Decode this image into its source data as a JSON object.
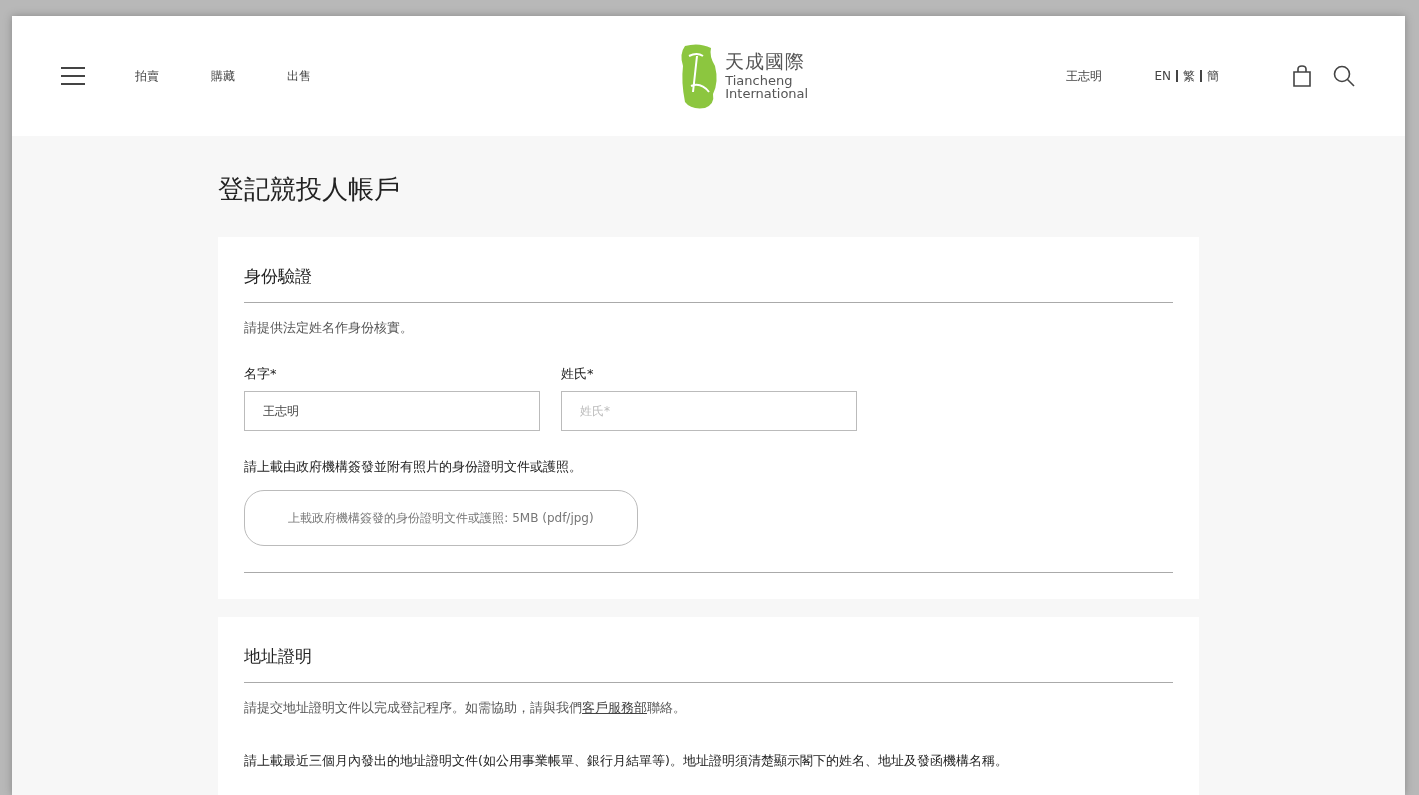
{
  "header": {
    "nav": [
      "拍賣",
      "購藏",
      "出售"
    ],
    "logo": {
      "chinese": "天成國際",
      "line1": "Tiancheng",
      "line2": "International"
    },
    "user": "王志明",
    "languages": [
      "EN",
      "繁",
      "簡"
    ]
  },
  "page_title": "登記競投人帳戶",
  "identity": {
    "heading": "身份驗證",
    "intro": "請提供法定姓名作身份核實。",
    "fields": [
      {
        "label": "名字*",
        "value": "王志明"
      },
      {
        "label": "姓氏*",
        "placeholder": "姓氏*"
      }
    ],
    "upload_note": "請上載由政府機構簽發並附有照片的身份證明文件或護照。",
    "upload_button": "上載政府機構簽發的身份證明文件或護照: 5MB (pdf/jpg)"
  },
  "address": {
    "heading": "地址證明",
    "intro_before": "請提交地址證明文件以完成登記程序。如需協助，請與我們",
    "intro_link": "客戶服務部",
    "intro_after": "聯絡。",
    "upload_note": "請上載最近三個月內發出的地址證明文件(如公用事業帳單、銀行月結單等)。地址證明須清楚顯示閣下的姓名、地址及發函機構名稱。"
  }
}
